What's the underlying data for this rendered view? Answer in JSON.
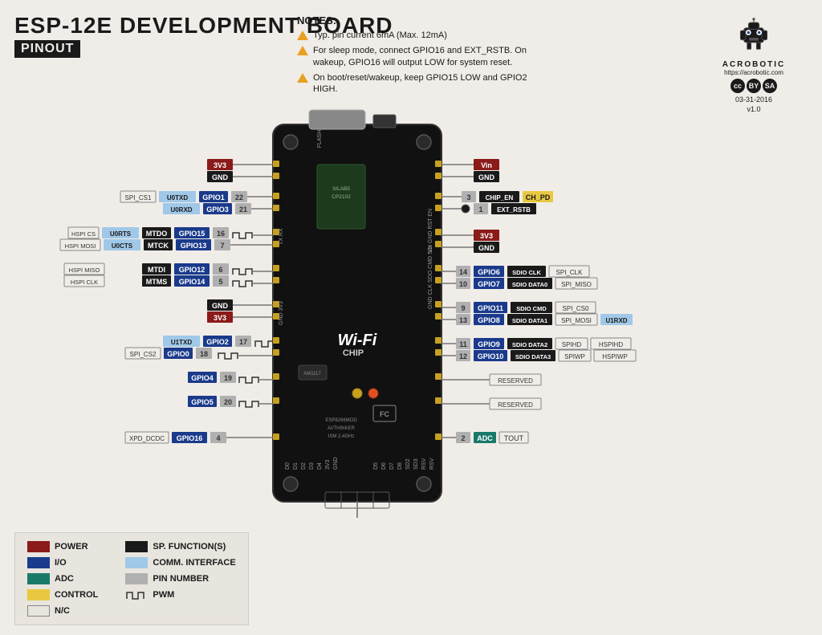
{
  "header": {
    "title": "ESP-12E DEVELOPMENT BOARD",
    "subtitle": "PINOUT"
  },
  "notes": {
    "title": "NOTES:",
    "items": [
      "Typ. pin current 6mA (Max. 12mA)",
      "For sleep mode, connect GPIO16 and EXT_RSTB. On wakeup, GPIO16 will output LOW for system reset.",
      "On boot/reset/wakeup, keep GPIO15 LOW and GPIO2 HIGH."
    ]
  },
  "logo": {
    "url": "https://acrobotic.com",
    "date": "03-31-2016",
    "version": "v1.0"
  },
  "legend": {
    "items": [
      {
        "label": "POWER",
        "color": "#8b1a1a"
      },
      {
        "label": "I/O",
        "color": "#1a3a8b"
      },
      {
        "label": "ADC",
        "color": "#1a7a6a"
      },
      {
        "label": "CONTROL",
        "color": "#e8c840"
      },
      {
        "label": "N/C",
        "color": "transparent"
      },
      {
        "label": "SP. FUNCTION(S)",
        "color": "#1a1a1a"
      },
      {
        "label": "COMM. INTERFACE",
        "color": "#a0c8e8"
      },
      {
        "label": "PIN NUMBER",
        "color": "#b0b0b0"
      },
      {
        "label": "PWM",
        "color": "wave"
      }
    ]
  },
  "left_pins": [
    {
      "row": 1,
      "labels": [
        {
          "text": "3V3",
          "class": "pin-red"
        }
      ],
      "gpio": ""
    },
    {
      "row": 2,
      "labels": [
        {
          "text": "GND",
          "class": "pin-dark"
        }
      ],
      "gpio": ""
    },
    {
      "row": 3,
      "labels": [
        {
          "text": "SPI_CS1",
          "class": "pin-none"
        },
        {
          "text": "U0TXD",
          "class": "pin-light-blue"
        },
        {
          "text": "GPIO1",
          "class": "pin-blue"
        },
        {
          "text": "22",
          "class": "pin-gray"
        }
      ],
      "gpio": "GPIO1"
    },
    {
      "row": 4,
      "labels": [
        {
          "text": "U0RXD",
          "class": "pin-light-blue"
        },
        {
          "text": "GPIO3",
          "class": "pin-blue"
        },
        {
          "text": "21",
          "class": "pin-gray"
        }
      ],
      "gpio": "GPIO3"
    },
    {
      "row": 5,
      "labels": [
        {
          "text": "HSPI CS",
          "class": "pin-none"
        },
        {
          "text": "U0RTS",
          "class": "pin-light-blue"
        },
        {
          "text": "MTDO",
          "class": "pin-dark"
        },
        {
          "text": "GPIO15",
          "class": "pin-blue"
        },
        {
          "text": "16",
          "class": "pin-gray"
        }
      ],
      "gpio": "GPIO15"
    },
    {
      "row": 6,
      "labels": [
        {
          "text": "HSPI MOSI",
          "class": "pin-none"
        },
        {
          "text": "U0CTS",
          "class": "pin-light-blue"
        },
        {
          "text": "MTCK",
          "class": "pin-dark"
        },
        {
          "text": "GPIO13",
          "class": "pin-blue"
        },
        {
          "text": "7",
          "class": "pin-gray"
        }
      ],
      "gpio": "GPIO13"
    },
    {
      "row": 7,
      "labels": [
        {
          "text": "HSPI MISO",
          "class": "pin-none"
        },
        {
          "text": "MTDI",
          "class": "pin-dark"
        },
        {
          "text": "GPIO12",
          "class": "pin-blue"
        },
        {
          "text": "6",
          "class": "pin-gray"
        }
      ],
      "gpio": "GPIO12"
    },
    {
      "row": 8,
      "labels": [
        {
          "text": "HSPI CLK",
          "class": "pin-none"
        },
        {
          "text": "MTMS",
          "class": "pin-dark"
        },
        {
          "text": "GPIO14",
          "class": "pin-blue"
        },
        {
          "text": "5",
          "class": "pin-gray"
        }
      ],
      "gpio": "GPIO14"
    },
    {
      "row": 9,
      "labels": [
        {
          "text": "GND",
          "class": "pin-dark"
        }
      ],
      "gpio": ""
    },
    {
      "row": 10,
      "labels": [
        {
          "text": "3V3",
          "class": "pin-red"
        }
      ],
      "gpio": ""
    },
    {
      "row": 11,
      "labels": [
        {
          "text": "U1TXD",
          "class": "pin-light-blue"
        },
        {
          "text": "GPIO2",
          "class": "pin-blue"
        },
        {
          "text": "17",
          "class": "pin-gray"
        }
      ],
      "gpio": "GPIO2"
    },
    {
      "row": 12,
      "labels": [
        {
          "text": "SPI_CS2",
          "class": "pin-none"
        },
        {
          "text": "GPIO0",
          "class": "pin-blue"
        },
        {
          "text": "18",
          "class": "pin-gray"
        }
      ],
      "gpio": "GPIO0"
    },
    {
      "row": 13,
      "labels": [
        {
          "text": "GPIO4",
          "class": "pin-blue"
        },
        {
          "text": "19",
          "class": "pin-gray"
        }
      ],
      "gpio": "GPIO4"
    },
    {
      "row": 14,
      "labels": [
        {
          "text": "GPIO5",
          "class": "pin-blue"
        },
        {
          "text": "20",
          "class": "pin-gray"
        }
      ],
      "gpio": "GPIO5"
    },
    {
      "row": 15,
      "labels": [
        {
          "text": "XPD_DCDC",
          "class": "pin-none"
        },
        {
          "text": "GPIO16",
          "class": "pin-blue"
        },
        {
          "text": "4",
          "class": "pin-gray"
        }
      ],
      "gpio": "GPIO16"
    }
  ],
  "right_pins": [
    {
      "row": 1,
      "labels": [
        {
          "text": "Vin",
          "class": "pin-red"
        }
      ]
    },
    {
      "row": 2,
      "labels": [
        {
          "text": "GND",
          "class": "pin-dark"
        }
      ]
    },
    {
      "row": 3,
      "labels": [
        {
          "text": "3",
          "class": "pin-gray"
        },
        {
          "text": "CHIP_EN",
          "class": "pin-dark"
        },
        {
          "text": "CH_PD",
          "class": "pin-yellow"
        }
      ]
    },
    {
      "row": 4,
      "labels": [
        {
          "text": "1",
          "class": "pin-gray"
        },
        {
          "text": "EXT_RSTB",
          "class": "pin-dark"
        }
      ]
    },
    {
      "row": 5,
      "labels": [
        {
          "text": "3V3",
          "class": "pin-red"
        }
      ]
    },
    {
      "row": 6,
      "labels": [
        {
          "text": "GND",
          "class": "pin-dark"
        }
      ]
    },
    {
      "row": 7,
      "labels": [
        {
          "text": "14",
          "class": "pin-gray"
        },
        {
          "text": "GPIO6",
          "class": "pin-blue"
        },
        {
          "text": "SDIO CLK",
          "class": "pin-dark"
        },
        {
          "text": "SPI_CLK",
          "class": "pin-none"
        }
      ]
    },
    {
      "row": 8,
      "labels": [
        {
          "text": "10",
          "class": "pin-gray"
        },
        {
          "text": "GPIO7",
          "class": "pin-blue"
        },
        {
          "text": "SDIO DATA0",
          "class": "pin-dark"
        },
        {
          "text": "SPI_MISO",
          "class": "pin-none"
        }
      ]
    },
    {
      "row": 9,
      "labels": [
        {
          "text": "9",
          "class": "pin-gray"
        },
        {
          "text": "GPIO11",
          "class": "pin-blue"
        },
        {
          "text": "SDIO CMD",
          "class": "pin-dark"
        },
        {
          "text": "SPI_CS0",
          "class": "pin-none"
        }
      ]
    },
    {
      "row": 10,
      "labels": [
        {
          "text": "13",
          "class": "pin-gray"
        },
        {
          "text": "GPIO8",
          "class": "pin-blue"
        },
        {
          "text": "SDIO DATA1",
          "class": "pin-dark"
        },
        {
          "text": "SPI_MOSI",
          "class": "pin-none"
        },
        {
          "text": "U1RXD",
          "class": "pin-light-blue"
        }
      ]
    },
    {
      "row": 11,
      "labels": [
        {
          "text": "11",
          "class": "pin-gray"
        },
        {
          "text": "GPIO9",
          "class": "pin-blue"
        },
        {
          "text": "SDIO DATA2",
          "class": "pin-dark"
        },
        {
          "text": "SPIHD",
          "class": "pin-none"
        },
        {
          "text": "HSPIHD",
          "class": "pin-none"
        }
      ]
    },
    {
      "row": 12,
      "labels": [
        {
          "text": "12",
          "class": "pin-gray"
        },
        {
          "text": "GPIO10",
          "class": "pin-blue"
        },
        {
          "text": "SDIO DATA3",
          "class": "pin-dark"
        },
        {
          "text": "SPIWP",
          "class": "pin-none"
        },
        {
          "text": "HSPIWP",
          "class": "pin-none"
        }
      ]
    },
    {
      "row": 13,
      "labels": [
        {
          "text": "RESERVED",
          "class": "pin-none"
        }
      ]
    },
    {
      "row": 14,
      "labels": [
        {
          "text": "RESERVED",
          "class": "pin-none"
        }
      ]
    },
    {
      "row": 15,
      "labels": [
        {
          "text": "2",
          "class": "pin-gray"
        },
        {
          "text": "ADC",
          "class": "pin-teal"
        },
        {
          "text": "TOUT",
          "class": "pin-none"
        }
      ]
    }
  ]
}
